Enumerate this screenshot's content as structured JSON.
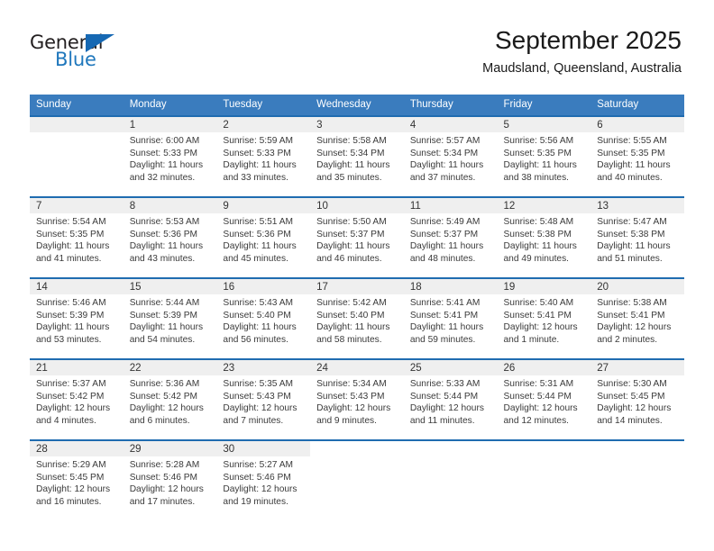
{
  "logo": {
    "word_top": "General",
    "word_bottom": "Blue",
    "triangle_color": "#1668b3",
    "text_color": "#231f20",
    "blue_color": "#1f77bc"
  },
  "header": {
    "title": "September 2025",
    "subtitle": "Maudsland, Queensland, Australia"
  },
  "colors": {
    "header_blue": "#3a7cbe",
    "row_divider_blue": "#1f6cb0",
    "daynum_strip": "#efefef"
  },
  "weekday_headers": [
    "Sunday",
    "Monday",
    "Tuesday",
    "Wednesday",
    "Thursday",
    "Friday",
    "Saturday"
  ],
  "weeks": [
    [
      {
        "day": "",
        "sunrise": "",
        "sunset": "",
        "daylight1": "",
        "daylight2": "",
        "empty": true
      },
      {
        "day": "1",
        "sunrise": "Sunrise: 6:00 AM",
        "sunset": "Sunset: 5:33 PM",
        "daylight1": "Daylight: 11 hours",
        "daylight2": "and 32 minutes."
      },
      {
        "day": "2",
        "sunrise": "Sunrise: 5:59 AM",
        "sunset": "Sunset: 5:33 PM",
        "daylight1": "Daylight: 11 hours",
        "daylight2": "and 33 minutes."
      },
      {
        "day": "3",
        "sunrise": "Sunrise: 5:58 AM",
        "sunset": "Sunset: 5:34 PM",
        "daylight1": "Daylight: 11 hours",
        "daylight2": "and 35 minutes."
      },
      {
        "day": "4",
        "sunrise": "Sunrise: 5:57 AM",
        "sunset": "Sunset: 5:34 PM",
        "daylight1": "Daylight: 11 hours",
        "daylight2": "and 37 minutes."
      },
      {
        "day": "5",
        "sunrise": "Sunrise: 5:56 AM",
        "sunset": "Sunset: 5:35 PM",
        "daylight1": "Daylight: 11 hours",
        "daylight2": "and 38 minutes."
      },
      {
        "day": "6",
        "sunrise": "Sunrise: 5:55 AM",
        "sunset": "Sunset: 5:35 PM",
        "daylight1": "Daylight: 11 hours",
        "daylight2": "and 40 minutes."
      }
    ],
    [
      {
        "day": "7",
        "sunrise": "Sunrise: 5:54 AM",
        "sunset": "Sunset: 5:35 PM",
        "daylight1": "Daylight: 11 hours",
        "daylight2": "and 41 minutes."
      },
      {
        "day": "8",
        "sunrise": "Sunrise: 5:53 AM",
        "sunset": "Sunset: 5:36 PM",
        "daylight1": "Daylight: 11 hours",
        "daylight2": "and 43 minutes."
      },
      {
        "day": "9",
        "sunrise": "Sunrise: 5:51 AM",
        "sunset": "Sunset: 5:36 PM",
        "daylight1": "Daylight: 11 hours",
        "daylight2": "and 45 minutes."
      },
      {
        "day": "10",
        "sunrise": "Sunrise: 5:50 AM",
        "sunset": "Sunset: 5:37 PM",
        "daylight1": "Daylight: 11 hours",
        "daylight2": "and 46 minutes."
      },
      {
        "day": "11",
        "sunrise": "Sunrise: 5:49 AM",
        "sunset": "Sunset: 5:37 PM",
        "daylight1": "Daylight: 11 hours",
        "daylight2": "and 48 minutes."
      },
      {
        "day": "12",
        "sunrise": "Sunrise: 5:48 AM",
        "sunset": "Sunset: 5:38 PM",
        "daylight1": "Daylight: 11 hours",
        "daylight2": "and 49 minutes."
      },
      {
        "day": "13",
        "sunrise": "Sunrise: 5:47 AM",
        "sunset": "Sunset: 5:38 PM",
        "daylight1": "Daylight: 11 hours",
        "daylight2": "and 51 minutes."
      }
    ],
    [
      {
        "day": "14",
        "sunrise": "Sunrise: 5:46 AM",
        "sunset": "Sunset: 5:39 PM",
        "daylight1": "Daylight: 11 hours",
        "daylight2": "and 53 minutes."
      },
      {
        "day": "15",
        "sunrise": "Sunrise: 5:44 AM",
        "sunset": "Sunset: 5:39 PM",
        "daylight1": "Daylight: 11 hours",
        "daylight2": "and 54 minutes."
      },
      {
        "day": "16",
        "sunrise": "Sunrise: 5:43 AM",
        "sunset": "Sunset: 5:40 PM",
        "daylight1": "Daylight: 11 hours",
        "daylight2": "and 56 minutes."
      },
      {
        "day": "17",
        "sunrise": "Sunrise: 5:42 AM",
        "sunset": "Sunset: 5:40 PM",
        "daylight1": "Daylight: 11 hours",
        "daylight2": "and 58 minutes."
      },
      {
        "day": "18",
        "sunrise": "Sunrise: 5:41 AM",
        "sunset": "Sunset: 5:41 PM",
        "daylight1": "Daylight: 11 hours",
        "daylight2": "and 59 minutes."
      },
      {
        "day": "19",
        "sunrise": "Sunrise: 5:40 AM",
        "sunset": "Sunset: 5:41 PM",
        "daylight1": "Daylight: 12 hours",
        "daylight2": "and 1 minute."
      },
      {
        "day": "20",
        "sunrise": "Sunrise: 5:38 AM",
        "sunset": "Sunset: 5:41 PM",
        "daylight1": "Daylight: 12 hours",
        "daylight2": "and 2 minutes."
      }
    ],
    [
      {
        "day": "21",
        "sunrise": "Sunrise: 5:37 AM",
        "sunset": "Sunset: 5:42 PM",
        "daylight1": "Daylight: 12 hours",
        "daylight2": "and 4 minutes."
      },
      {
        "day": "22",
        "sunrise": "Sunrise: 5:36 AM",
        "sunset": "Sunset: 5:42 PM",
        "daylight1": "Daylight: 12 hours",
        "daylight2": "and 6 minutes."
      },
      {
        "day": "23",
        "sunrise": "Sunrise: 5:35 AM",
        "sunset": "Sunset: 5:43 PM",
        "daylight1": "Daylight: 12 hours",
        "daylight2": "and 7 minutes."
      },
      {
        "day": "24",
        "sunrise": "Sunrise: 5:34 AM",
        "sunset": "Sunset: 5:43 PM",
        "daylight1": "Daylight: 12 hours",
        "daylight2": "and 9 minutes."
      },
      {
        "day": "25",
        "sunrise": "Sunrise: 5:33 AM",
        "sunset": "Sunset: 5:44 PM",
        "daylight1": "Daylight: 12 hours",
        "daylight2": "and 11 minutes."
      },
      {
        "day": "26",
        "sunrise": "Sunrise: 5:31 AM",
        "sunset": "Sunset: 5:44 PM",
        "daylight1": "Daylight: 12 hours",
        "daylight2": "and 12 minutes."
      },
      {
        "day": "27",
        "sunrise": "Sunrise: 5:30 AM",
        "sunset": "Sunset: 5:45 PM",
        "daylight1": "Daylight: 12 hours",
        "daylight2": "and 14 minutes."
      }
    ],
    [
      {
        "day": "28",
        "sunrise": "Sunrise: 5:29 AM",
        "sunset": "Sunset: 5:45 PM",
        "daylight1": "Daylight: 12 hours",
        "daylight2": "and 16 minutes."
      },
      {
        "day": "29",
        "sunrise": "Sunrise: 5:28 AM",
        "sunset": "Sunset: 5:46 PM",
        "daylight1": "Daylight: 12 hours",
        "daylight2": "and 17 minutes."
      },
      {
        "day": "30",
        "sunrise": "Sunrise: 5:27 AM",
        "sunset": "Sunset: 5:46 PM",
        "daylight1": "Daylight: 12 hours",
        "daylight2": "and 19 minutes."
      },
      {
        "day": "",
        "sunrise": "",
        "sunset": "",
        "daylight1": "",
        "daylight2": "",
        "blank": true
      },
      {
        "day": "",
        "sunrise": "",
        "sunset": "",
        "daylight1": "",
        "daylight2": "",
        "blank": true
      },
      {
        "day": "",
        "sunrise": "",
        "sunset": "",
        "daylight1": "",
        "daylight2": "",
        "blank": true
      },
      {
        "day": "",
        "sunrise": "",
        "sunset": "",
        "daylight1": "",
        "daylight2": "",
        "blank": true
      }
    ]
  ]
}
